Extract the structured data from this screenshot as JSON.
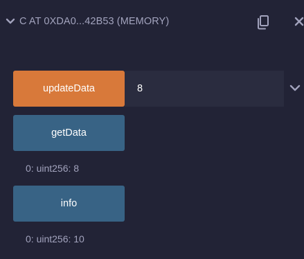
{
  "contract": {
    "title": "C AT 0XDA0...42B53 (MEMORY)",
    "toggle_icon": "chevron-down-icon",
    "copy_icon": "copy-icon",
    "close_icon": "close-icon"
  },
  "functions": [
    {
      "label": "updateData",
      "kind": "transact",
      "input_value": "8",
      "expand_icon": "chevron-down-icon"
    },
    {
      "label": "getData",
      "kind": "call",
      "result": "0: uint256: 8"
    },
    {
      "label": "info",
      "kind": "call",
      "result": "0: uint256: 10"
    }
  ],
  "colors": {
    "background": "#222336",
    "transact_button": "#d8793a",
    "call_button": "#386385",
    "input_background": "#2a2c3f",
    "text_muted": "#a2a3bd"
  }
}
